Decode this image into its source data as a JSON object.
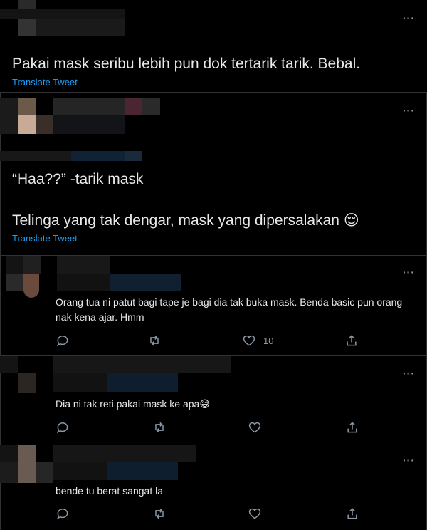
{
  "tweet1": {
    "text": "Pakai mask seribu lebih pun dok tertarik tarik. Bebal.",
    "translate": "Translate Tweet",
    "more": "···"
  },
  "tweet2": {
    "line1": "“Haa??” -tarik mask",
    "line2": "Telinga yang tak dengar, mask yang dipersalakan",
    "emoji": "😌",
    "translate": "Translate Tweet",
    "more": "···"
  },
  "replies": [
    {
      "text": "Orang tua ni patut bagi tape je bagi dia tak buka mask. Benda basic pun orang nak kena ajar. Hmm",
      "likes": "10",
      "more": "···"
    },
    {
      "text": "Dia ni tak reti pakai mask ke apa",
      "emoji": "😅",
      "likes": "",
      "more": "···"
    },
    {
      "text": "bende tu berat sangat la",
      "likes": "",
      "more": "···"
    }
  ],
  "icons": [
    "reply-icon",
    "retweet-icon",
    "like-icon",
    "share-icon",
    "more-icon"
  ]
}
